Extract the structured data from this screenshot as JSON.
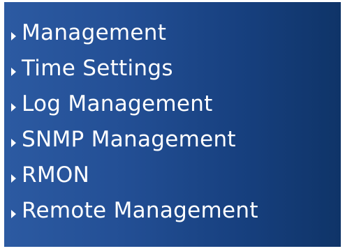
{
  "menu": {
    "items": [
      {
        "label": "Management",
        "icon": "triangle-right-icon"
      },
      {
        "label": "Time Settings",
        "icon": "triangle-right-icon"
      },
      {
        "label": "Log Management",
        "icon": "triangle-right-icon"
      },
      {
        "label": "SNMP Management",
        "icon": "triangle-right-icon"
      },
      {
        "label": "RMON",
        "icon": "triangle-right-icon"
      },
      {
        "label": "Remote Management",
        "icon": "triangle-right-icon"
      }
    ]
  },
  "colors": {
    "panel_left": "#2c5aa2",
    "panel_right": "#0f3468",
    "text": "#ffffff"
  }
}
